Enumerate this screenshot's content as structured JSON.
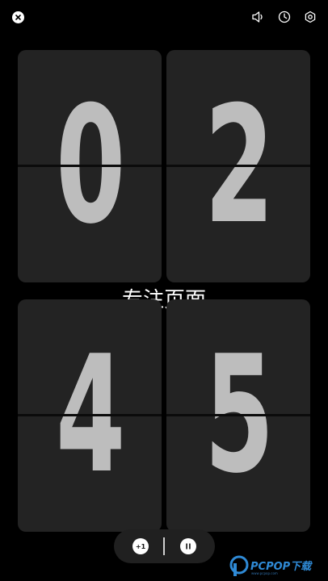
{
  "top_bar": {
    "close_icon": "close-icon",
    "icons": [
      "speaker-icon",
      "clock-icon",
      "settings-icon"
    ]
  },
  "clock": {
    "digits": [
      "0",
      "2",
      "4",
      "5"
    ]
  },
  "focus_label": "专注页面",
  "controls": {
    "add_label": "+1",
    "pause_icon": "pause-icon"
  },
  "watermark": {
    "text": "PCPOP下载",
    "subtext": "www.pcpop.com"
  },
  "colors": {
    "background": "#000000",
    "card": "#232323",
    "digit": "#bdbdbd",
    "watermark": "#2f8ad6"
  }
}
